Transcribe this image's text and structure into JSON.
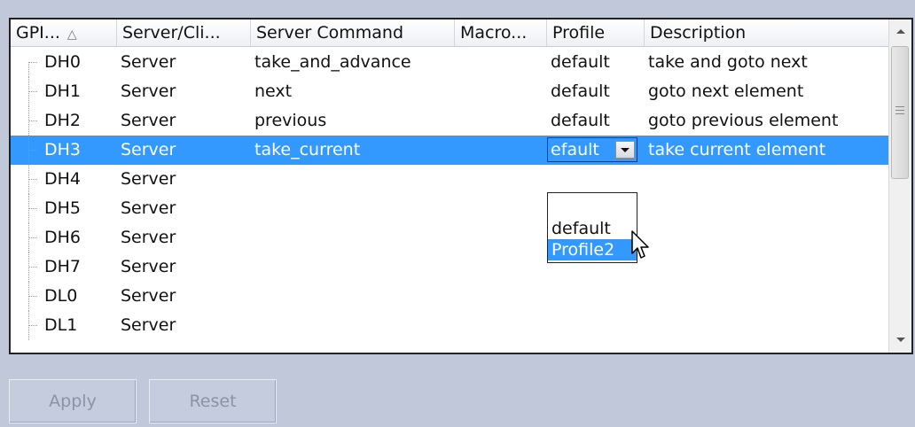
{
  "columns": [
    {
      "label": "GPI...",
      "sort_icon": "△"
    },
    {
      "label": "Server/Cli..."
    },
    {
      "label": "Server Command"
    },
    {
      "label": "Macro..."
    },
    {
      "label": "Profile"
    },
    {
      "label": "Description"
    }
  ],
  "rows": [
    {
      "gpi": "DH0",
      "server_client": "Server",
      "command": "take_and_advance",
      "macro": "",
      "profile": "default",
      "description": "take and goto next"
    },
    {
      "gpi": "DH1",
      "server_client": "Server",
      "command": "next",
      "macro": "",
      "profile": "default",
      "description": "goto next element"
    },
    {
      "gpi": "DH2",
      "server_client": "Server",
      "command": "previous",
      "macro": "",
      "profile": "default",
      "description": "goto previous element"
    },
    {
      "gpi": "DH3",
      "server_client": "Server",
      "command": "take_current",
      "macro": "",
      "profile": "default",
      "description": "take current element"
    },
    {
      "gpi": "DH4",
      "server_client": "Server",
      "command": "",
      "macro": "",
      "profile": "",
      "description": ""
    },
    {
      "gpi": "DH5",
      "server_client": "Server",
      "command": "",
      "macro": "",
      "profile": "",
      "description": ""
    },
    {
      "gpi": "DH6",
      "server_client": "Server",
      "command": "",
      "macro": "",
      "profile": "",
      "description": ""
    },
    {
      "gpi": "DH7",
      "server_client": "Server",
      "command": "",
      "macro": "",
      "profile": "",
      "description": ""
    },
    {
      "gpi": "DL0",
      "server_client": "Server",
      "command": "",
      "macro": "",
      "profile": "",
      "description": ""
    },
    {
      "gpi": "DL1",
      "server_client": "Server",
      "command": "",
      "macro": "",
      "profile": "",
      "description": ""
    }
  ],
  "selected_row": 3,
  "profile_combo": {
    "value": "default",
    "options": [
      "default",
      "Profile2"
    ],
    "highlighted": "Profile2"
  },
  "buttons": {
    "apply": "Apply",
    "reset": "Reset"
  },
  "colors": {
    "selection": "#3399ff",
    "background": "#c0c8da"
  }
}
